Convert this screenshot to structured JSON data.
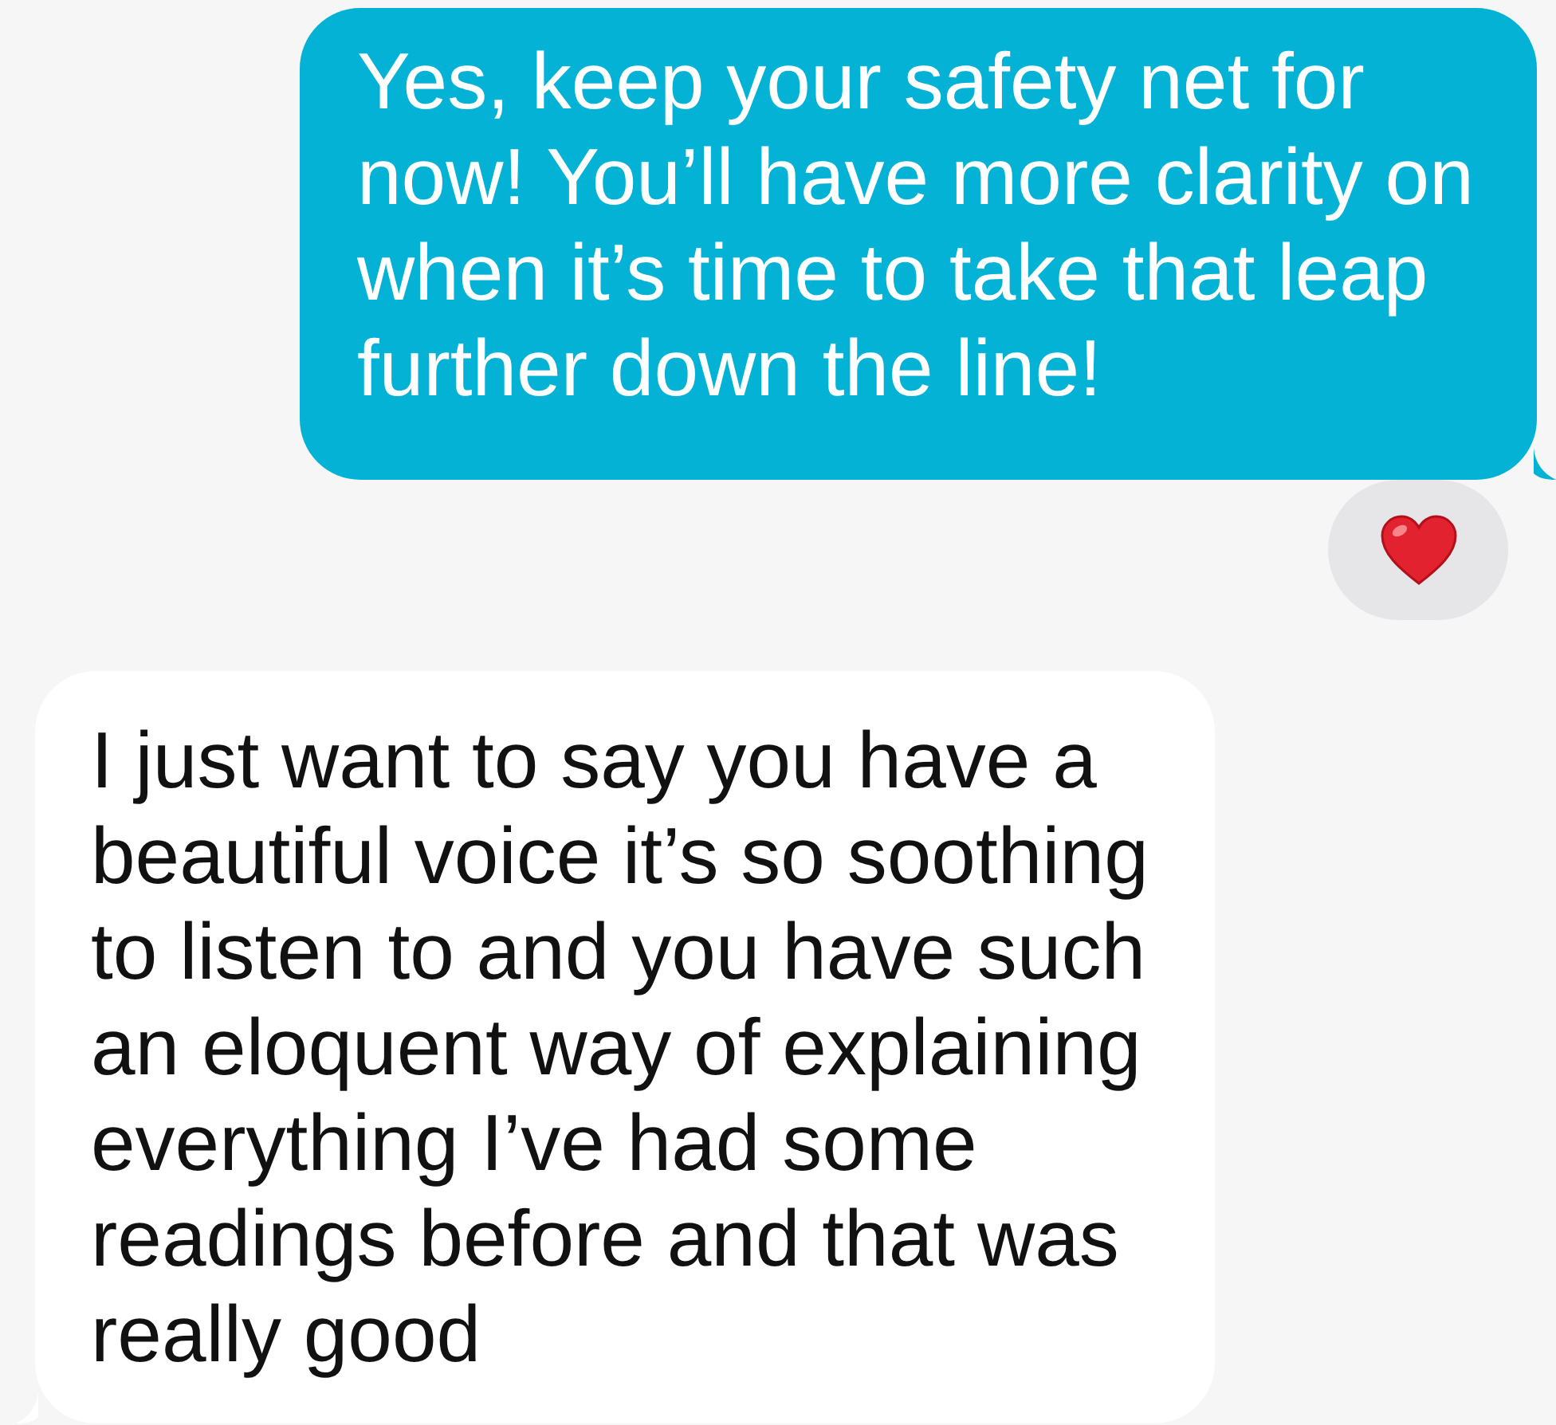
{
  "messages": [
    {
      "kind": "sent",
      "text": "Yes, keep your safety net for now! You’ll have more clarity on when it’s time to take that leap further down the line!",
      "reacted": true
    },
    {
      "kind": "received",
      "text": "I just want to say you have a beautiful voice it’s so soothing to listen to and you have such an eloquent way of explaining everything I’ve had some readings before and that was really good",
      "reacted": false
    }
  ]
}
